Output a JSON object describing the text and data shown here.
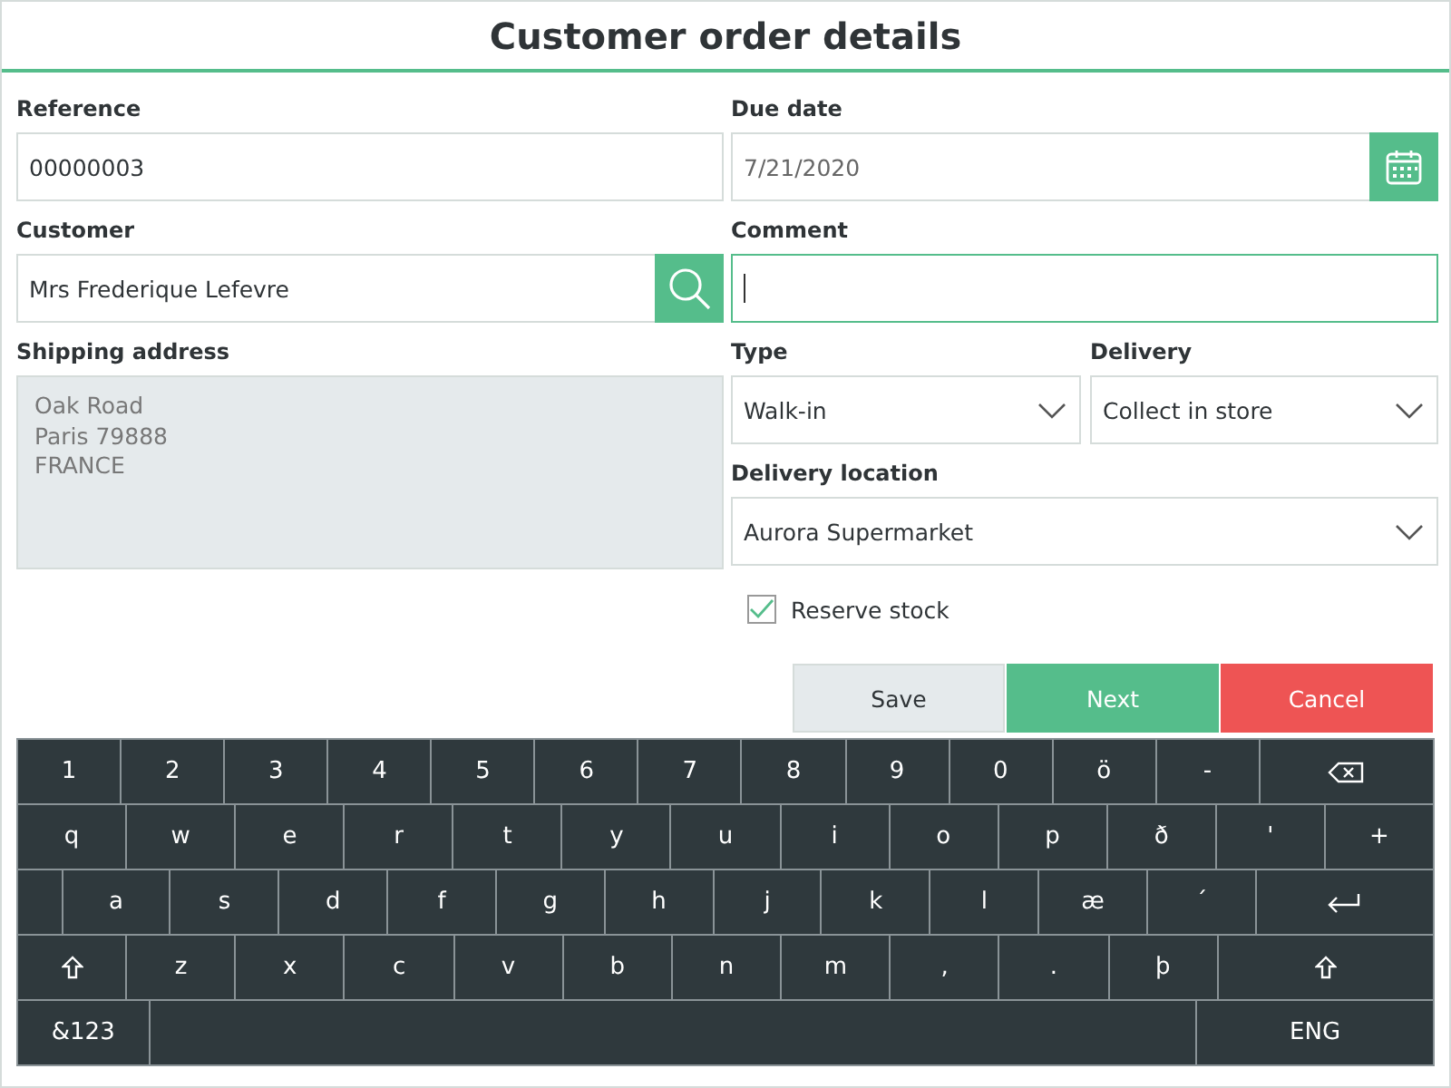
{
  "title": "Customer order details",
  "reference": {
    "label": "Reference",
    "value": "00000003"
  },
  "due_date": {
    "label": "Due date",
    "value": "7/21/2020"
  },
  "customer": {
    "label": "Customer",
    "value": "Mrs Frederique Lefevre"
  },
  "comment": {
    "label": "Comment",
    "focused": true
  },
  "shipping_address": {
    "label": "Shipping address",
    "disabled": true,
    "lines": [
      "Oak Road",
      "Paris 79888",
      "FRANCE"
    ]
  },
  "type": {
    "label": "Type",
    "value": "Walk-in"
  },
  "delivery": {
    "label": "Delivery",
    "value": "Collect in store"
  },
  "delivery_location": {
    "label": "Delivery location",
    "value": "Aurora Supermarket"
  },
  "reserve_stock": {
    "label": "Reserve stock",
    "checked": true
  },
  "buttons": [
    {
      "label": "Save",
      "kind": "neutral"
    },
    {
      "label": "Next",
      "kind": "primary"
    },
    {
      "label": "Cancel",
      "kind": "danger"
    }
  ],
  "keyboard": [
    [
      {
        "kind": "char",
        "label": "1"
      },
      {
        "kind": "char",
        "label": "2"
      },
      {
        "kind": "char",
        "label": "3"
      },
      {
        "kind": "char",
        "label": "4"
      },
      {
        "kind": "char",
        "label": "5"
      },
      {
        "kind": "char",
        "label": "6"
      },
      {
        "kind": "char",
        "label": "7"
      },
      {
        "kind": "char",
        "label": "8"
      },
      {
        "kind": "char",
        "label": "9"
      },
      {
        "kind": "char",
        "label": "0"
      },
      {
        "kind": "char",
        "label": "ö"
      },
      {
        "kind": "char",
        "label": "-"
      },
      {
        "kind": "backspace"
      }
    ],
    [
      {
        "kind": "char",
        "label": "q"
      },
      {
        "kind": "char",
        "label": "w"
      },
      {
        "kind": "char",
        "label": "e"
      },
      {
        "kind": "char",
        "label": "r"
      },
      {
        "kind": "char",
        "label": "t"
      },
      {
        "kind": "char",
        "label": "y"
      },
      {
        "kind": "char",
        "label": "u"
      },
      {
        "kind": "char",
        "label": "i"
      },
      {
        "kind": "char",
        "label": "o"
      },
      {
        "kind": "char",
        "label": "p"
      },
      {
        "kind": "char",
        "label": "ð"
      },
      {
        "kind": "char",
        "label": "'"
      },
      {
        "kind": "char",
        "label": "+"
      }
    ],
    [
      {
        "kind": "blank"
      },
      {
        "kind": "char",
        "label": "a"
      },
      {
        "kind": "char",
        "label": "s"
      },
      {
        "kind": "char",
        "label": "d"
      },
      {
        "kind": "char",
        "label": "f"
      },
      {
        "kind": "char",
        "label": "g"
      },
      {
        "kind": "char",
        "label": "h"
      },
      {
        "kind": "char",
        "label": "j"
      },
      {
        "kind": "char",
        "label": "k"
      },
      {
        "kind": "char",
        "label": "l"
      },
      {
        "kind": "char",
        "label": "æ"
      },
      {
        "kind": "char",
        "label": "´"
      },
      {
        "kind": "enter"
      }
    ],
    [
      {
        "kind": "shift"
      },
      {
        "kind": "char",
        "label": "z"
      },
      {
        "kind": "char",
        "label": "x"
      },
      {
        "kind": "char",
        "label": "c"
      },
      {
        "kind": "char",
        "label": "v"
      },
      {
        "kind": "char",
        "label": "b"
      },
      {
        "kind": "char",
        "label": "n"
      },
      {
        "kind": "char",
        "label": "m"
      },
      {
        "kind": "char",
        "label": ","
      },
      {
        "kind": "char",
        "label": "."
      },
      {
        "kind": "char",
        "label": "þ"
      },
      {
        "kind": "shift_wide"
      }
    ],
    [
      {
        "kind": "mode",
        "label": "&123"
      },
      {
        "kind": "space"
      },
      {
        "kind": "lang",
        "label": "ENG"
      }
    ]
  ]
}
